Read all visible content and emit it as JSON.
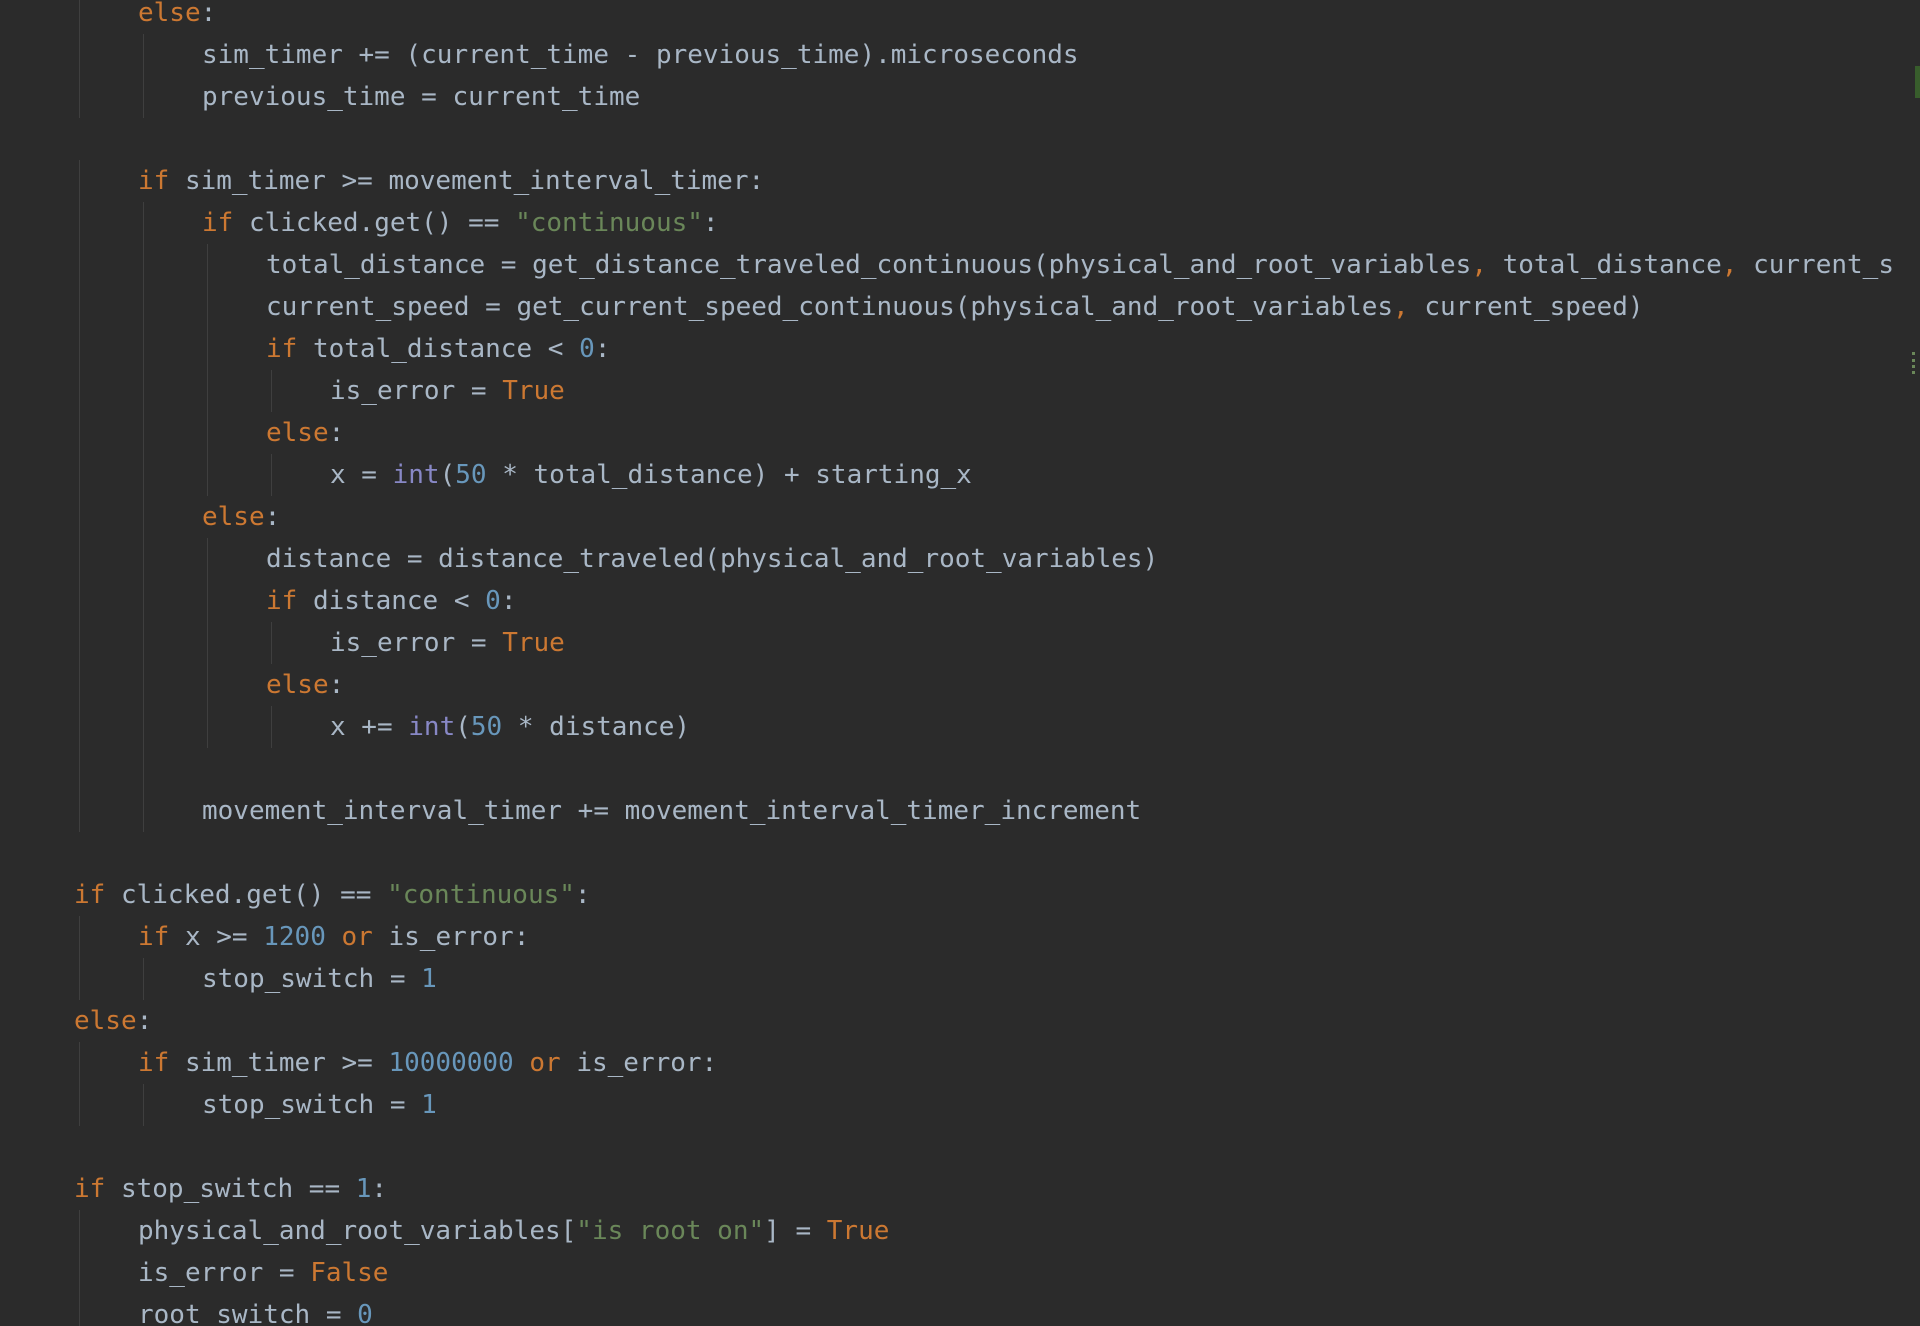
{
  "editor": {
    "language": "python",
    "colors": {
      "background": "#2b2b2b",
      "text": "#a9b7c6",
      "keyword": "#cc7832",
      "string": "#6a8759",
      "number": "#6897bb",
      "builtin": "#8888c6"
    },
    "lines": [
      {
        "indent": 1,
        "fold": true,
        "tokens": [
          {
            "t": "kw",
            "v": "else"
          },
          {
            "t": "op",
            "v": ":"
          }
        ]
      },
      {
        "indent": 2,
        "tokens": [
          {
            "t": "op",
            "v": "sim_timer += (current_time - previous_time).microseconds"
          }
        ]
      },
      {
        "indent": 2,
        "fold": true,
        "tokens": [
          {
            "t": "op",
            "v": "previous_time = current_time"
          }
        ]
      },
      {
        "indent": 0,
        "tokens": []
      },
      {
        "indent": 1,
        "fold": true,
        "tokens": [
          {
            "t": "kw",
            "v": "if"
          },
          {
            "t": "op",
            "v": " sim_timer >= movement_interval_timer:"
          }
        ]
      },
      {
        "indent": 2,
        "fold": true,
        "tokens": [
          {
            "t": "kw",
            "v": "if"
          },
          {
            "t": "op",
            "v": " clicked.get() == "
          },
          {
            "t": "str",
            "v": "\"continuous\""
          },
          {
            "t": "op",
            "v": ":"
          }
        ]
      },
      {
        "indent": 3,
        "tokens": [
          {
            "t": "op",
            "v": "total_distance = get_distance_traveled_continuous(physical_and_root_variables"
          },
          {
            "t": "comma",
            "v": ","
          },
          {
            "t": "op",
            "v": " total_distance"
          },
          {
            "t": "comma",
            "v": ","
          },
          {
            "t": "op",
            "v": " current_s"
          }
        ]
      },
      {
        "indent": 3,
        "tokens": [
          {
            "t": "op",
            "v": "current_speed = get_current_speed_continuous(physical_and_root_variables"
          },
          {
            "t": "comma",
            "v": ","
          },
          {
            "t": "op",
            "v": " current_speed)"
          }
        ]
      },
      {
        "indent": 3,
        "tokens": [
          {
            "t": "kw",
            "v": "if"
          },
          {
            "t": "op",
            "v": " total_distance < "
          },
          {
            "t": "num",
            "v": "0"
          },
          {
            "t": "op",
            "v": ":"
          }
        ]
      },
      {
        "indent": 4,
        "tokens": [
          {
            "t": "op",
            "v": "is_error = "
          },
          {
            "t": "const",
            "v": "True"
          }
        ]
      },
      {
        "indent": 3,
        "tokens": [
          {
            "t": "kw",
            "v": "else"
          },
          {
            "t": "op",
            "v": ":"
          }
        ]
      },
      {
        "indent": 4,
        "fold": true,
        "tokens": [
          {
            "t": "op",
            "v": "x = "
          },
          {
            "t": "fn",
            "v": "int"
          },
          {
            "t": "op",
            "v": "("
          },
          {
            "t": "num",
            "v": "50"
          },
          {
            "t": "op",
            "v": " * total_distance) + starting_x"
          }
        ]
      },
      {
        "indent": 2,
        "fold": true,
        "tokens": [
          {
            "t": "kw",
            "v": "else"
          },
          {
            "t": "op",
            "v": ":"
          }
        ]
      },
      {
        "indent": 3,
        "tokens": [
          {
            "t": "op",
            "v": "distance = distance_traveled(physical_and_root_variables)"
          }
        ]
      },
      {
        "indent": 3,
        "tokens": [
          {
            "t": "kw",
            "v": "if"
          },
          {
            "t": "op",
            "v": " distance < "
          },
          {
            "t": "num",
            "v": "0"
          },
          {
            "t": "op",
            "v": ":"
          }
        ]
      },
      {
        "indent": 4,
        "tokens": [
          {
            "t": "op",
            "v": "is_error = "
          },
          {
            "t": "const",
            "v": "True"
          }
        ]
      },
      {
        "indent": 3,
        "tokens": [
          {
            "t": "kw",
            "v": "else"
          },
          {
            "t": "op",
            "v": ":"
          }
        ]
      },
      {
        "indent": 4,
        "fold": true,
        "tokens": [
          {
            "t": "op",
            "v": "x += "
          },
          {
            "t": "fn",
            "v": "int"
          },
          {
            "t": "op",
            "v": "("
          },
          {
            "t": "num",
            "v": "50"
          },
          {
            "t": "op",
            "v": " * distance)"
          }
        ]
      },
      {
        "indent": 0,
        "guides": 2,
        "tokens": []
      },
      {
        "indent": 2,
        "fold": true,
        "tokens": [
          {
            "t": "op",
            "v": "movement_interval_timer += movement_interval_timer_increment"
          }
        ]
      },
      {
        "indent": 0,
        "tokens": []
      },
      {
        "indent": 0,
        "fold": true,
        "tokens": [
          {
            "t": "kw",
            "v": "if"
          },
          {
            "t": "op",
            "v": " clicked.get() == "
          },
          {
            "t": "str",
            "v": "\"continuous\""
          },
          {
            "t": "op",
            "v": ":"
          }
        ]
      },
      {
        "indent": 1,
        "fold": true,
        "tokens": [
          {
            "t": "kw",
            "v": "if"
          },
          {
            "t": "op",
            "v": " x >= "
          },
          {
            "t": "num",
            "v": "1200"
          },
          {
            "t": "op",
            "v": " "
          },
          {
            "t": "kw",
            "v": "or"
          },
          {
            "t": "op",
            "v": " is_error:"
          }
        ]
      },
      {
        "indent": 2,
        "fold": true,
        "tokens": [
          {
            "t": "op",
            "v": "stop_switch = "
          },
          {
            "t": "num",
            "v": "1"
          }
        ]
      },
      {
        "indent": 0,
        "fold": true,
        "tokens": [
          {
            "t": "kw",
            "v": "else"
          },
          {
            "t": "op",
            "v": ":"
          }
        ]
      },
      {
        "indent": 1,
        "tokens": [
          {
            "t": "kw",
            "v": "if"
          },
          {
            "t": "op",
            "v": " sim_timer >= "
          },
          {
            "t": "num",
            "v": "10000000"
          },
          {
            "t": "op",
            "v": " "
          },
          {
            "t": "kw",
            "v": "or"
          },
          {
            "t": "op",
            "v": " is_error:"
          }
        ]
      },
      {
        "indent": 2,
        "fold": true,
        "tokens": [
          {
            "t": "op",
            "v": "stop_switch = "
          },
          {
            "t": "num",
            "v": "1"
          }
        ]
      },
      {
        "indent": 0,
        "tokens": []
      },
      {
        "indent": 0,
        "fold": true,
        "tokens": [
          {
            "t": "kw",
            "v": "if"
          },
          {
            "t": "op",
            "v": " stop_switch == "
          },
          {
            "t": "num",
            "v": "1"
          },
          {
            "t": "op",
            "v": ":"
          }
        ]
      },
      {
        "indent": 1,
        "tokens": [
          {
            "t": "op",
            "v": "physical_and_root_variables["
          },
          {
            "t": "str",
            "v": "\"is root on\""
          },
          {
            "t": "op",
            "v": "] = "
          },
          {
            "t": "const",
            "v": "True"
          }
        ]
      },
      {
        "indent": 1,
        "tokens": [
          {
            "t": "op",
            "v": "is_error = "
          },
          {
            "t": "const",
            "v": "False"
          }
        ]
      },
      {
        "indent": 1,
        "tokens": [
          {
            "t": "op",
            "v": "root_switch = "
          },
          {
            "t": "num",
            "v": "0"
          }
        ]
      }
    ]
  }
}
